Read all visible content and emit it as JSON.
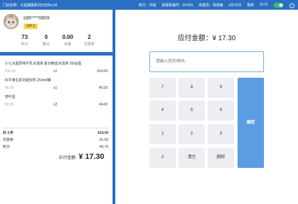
{
  "topbar": {
    "store": "门店名称：大益播展系列分店No.56",
    "district_label": "统方：中班",
    "register_label": "收银机编号：DY001",
    "cashier_label": "收银员：常晓静",
    "date": "4月15日",
    "weekday": "周四",
    "time": "15:21"
  },
  "member": {
    "phone": "186****0809",
    "vip": "VIP 3",
    "stats": [
      {
        "value": "73",
        "label": "积分"
      },
      {
        "value": "0",
        "label": "集点"
      },
      {
        "value": "0.00",
        "label": "余额"
      },
      {
        "value": "2",
        "label": "优惠券"
      }
    ]
  },
  "items": [
    {
      "name": "小七冰盒原味牛乳冰淇淋  夏日精选冰淇淋  250g/盒",
      "unit": "¥10.00",
      "qty": "x1",
      "total": "¥10.00"
    },
    {
      "name": "红牛维生素功能饮料 250ml/罐",
      "unit": "¥5.00",
      "qty": "x1",
      "total": "¥5.00"
    },
    {
      "name": "茶叶蛋",
      "unit": "¥2.00",
      "qty": "x2",
      "total": "¥4.00"
    }
  ],
  "summary": {
    "count_label": "共 4 件",
    "count_value": "¥19.00",
    "discount_label": "优惠券:",
    "discount_value": "-¥1.00",
    "points_label": "积分:",
    "points_value": "-¥0.70",
    "payable_label": "应付金额:",
    "payable_value": "¥ 17.30"
  },
  "payment": {
    "due_label": "应付金额：¥ 17.30",
    "password_placeholder": "请输入您的密码",
    "keys": [
      "7",
      "8",
      "9",
      "4",
      "5",
      "6",
      "1",
      "2",
      "3",
      "0",
      "清空",
      "删除"
    ],
    "confirm_label": "确定"
  },
  "colors": {
    "primary": "#2a6fc2",
    "confirm": "#5b9de3",
    "toggle": "#39c06a",
    "vip": "#f5d25a"
  }
}
